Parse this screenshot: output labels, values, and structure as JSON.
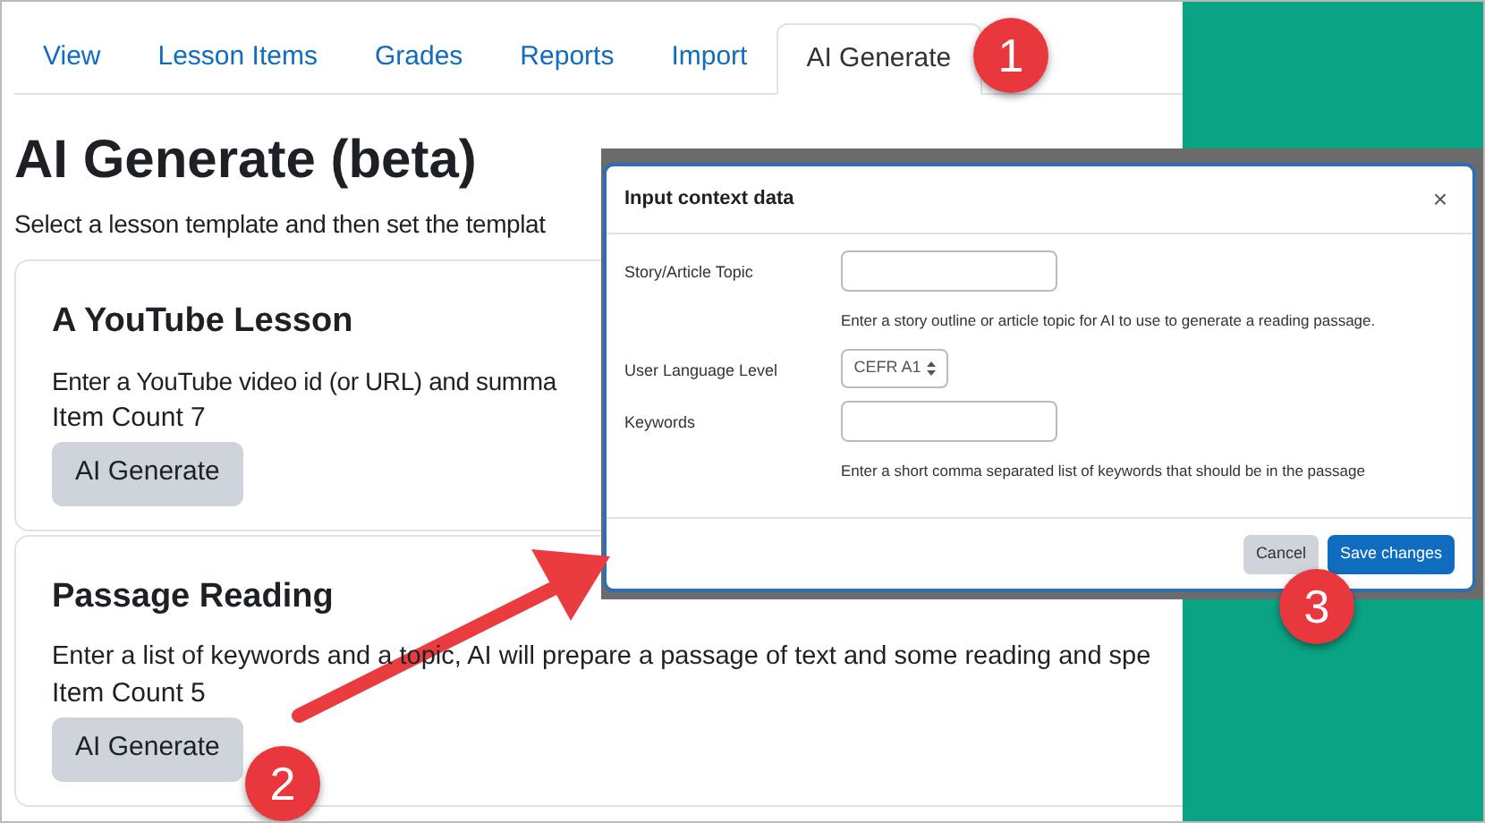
{
  "tabs": [
    {
      "label": "View",
      "selected": false
    },
    {
      "label": "Lesson Items",
      "selected": false
    },
    {
      "label": "Grades",
      "selected": false
    },
    {
      "label": "Reports",
      "selected": false
    },
    {
      "label": "Import",
      "selected": false
    },
    {
      "label": "AI Generate",
      "selected": true
    }
  ],
  "page": {
    "title": "AI Generate (beta)",
    "intro": "Select a lesson template and then set the templat"
  },
  "templates": [
    {
      "title": "A YouTube Lesson",
      "description": "Enter a YouTube video id (or URL) and summa",
      "item_count": "Item Count 7",
      "button": "AI Generate"
    },
    {
      "title": "Passage Reading",
      "description": "Enter a list of keywords and a topic, AI will prepare a passage of text and some reading and spe",
      "item_count": "Item Count 5",
      "button": "AI Generate"
    }
  ],
  "dialog": {
    "title": "Input context data",
    "close": "×",
    "fields": [
      {
        "kind": "text",
        "label": "Story/Article Topic",
        "help": "Enter a story outline or article topic for AI to use to generate a reading passage."
      },
      {
        "kind": "select",
        "label": "User Language Level",
        "value": "CEFR A1"
      },
      {
        "kind": "text",
        "label": "Keywords",
        "help": "Enter a short comma separated list of keywords that should be in the passage"
      }
    ],
    "buttons": [
      {
        "label": "Cancel",
        "kind": "secondary"
      },
      {
        "label": "Save changes",
        "kind": "primary"
      }
    ]
  },
  "callouts": [
    "1",
    "2",
    "3"
  ]
}
